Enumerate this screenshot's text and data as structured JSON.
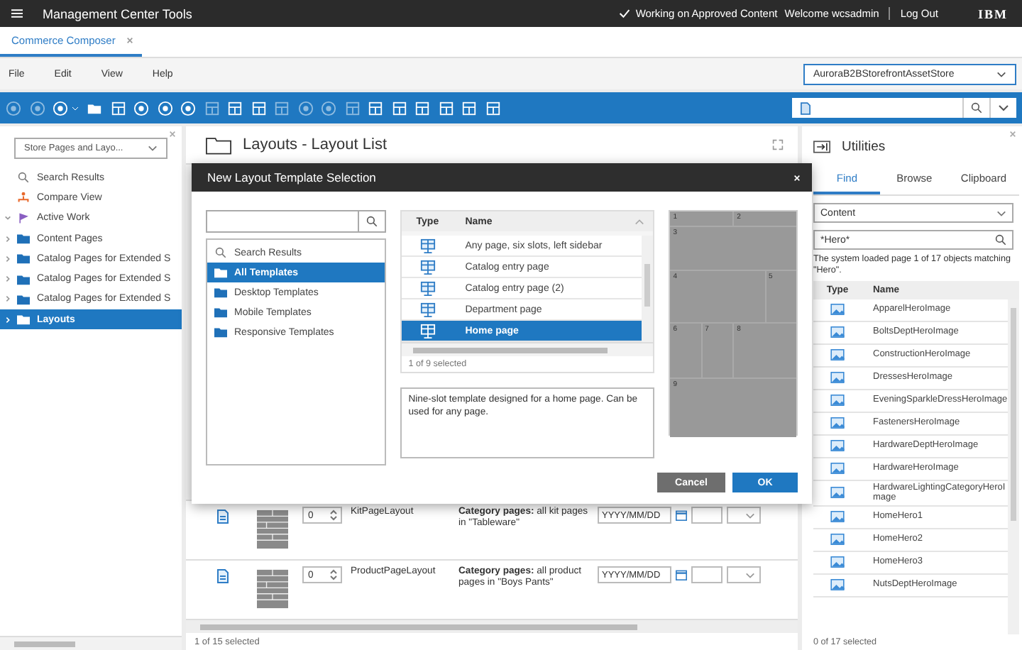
{
  "header": {
    "title": "Management Center Tools",
    "status": "Working on Approved Content",
    "welcome": "Welcome wcsadmin",
    "logout": "Log Out",
    "logo": "IBM"
  },
  "app_tabs": [
    {
      "label": "Commerce Composer",
      "selected": true
    }
  ],
  "menu": [
    "File",
    "Edit",
    "View",
    "Help"
  ],
  "store_selector": {
    "value": "AuroraB2BStorefrontAssetStore"
  },
  "explorer": {
    "view_selector": "Store Pages and Layo...",
    "items": [
      {
        "label": "Search Results",
        "kind": "search",
        "selected": false
      },
      {
        "label": "Compare View",
        "kind": "compare",
        "selected": false
      },
      {
        "label": "Active Work",
        "kind": "work",
        "expanded": true,
        "selected": false
      },
      {
        "label": "Content Pages",
        "kind": "folder",
        "expanded": false,
        "selected": false
      },
      {
        "label": "Catalog Pages for Extended S",
        "kind": "folder",
        "expanded": false,
        "selected": false
      },
      {
        "label": "Catalog Pages for Extended S",
        "kind": "folder",
        "expanded": false,
        "selected": false
      },
      {
        "label": "Catalog Pages for Extended S",
        "kind": "folder",
        "expanded": false,
        "selected": false
      },
      {
        "label": "Layouts",
        "kind": "folder",
        "expanded": false,
        "selected": true
      }
    ]
  },
  "layout_list": {
    "title": "Layouts - Layout List",
    "rows": [
      {
        "priority": "0",
        "name": "KitPageLayout",
        "description": "**Category pages:** all kit pages in \"Tableware\"",
        "date_placeholder": "YYYY/MM/DD",
        "selected": false
      },
      {
        "priority": "0",
        "name": "ProductPageLayout",
        "description": "**Category pages:** all product pages in \"Boys Pants\"",
        "date_placeholder": "YYYY/MM/DD",
        "selected": false
      }
    ],
    "status": "1 of 15 selected"
  },
  "dialog": {
    "title": "New Layout Template Selection",
    "folders": [
      {
        "label": "Search Results",
        "kind": "search",
        "selected": false
      },
      {
        "label": "All Templates",
        "kind": "folder",
        "selected": true
      },
      {
        "label": "Desktop Templates",
        "kind": "folder",
        "selected": false
      },
      {
        "label": "Mobile Templates",
        "kind": "folder",
        "selected": false
      },
      {
        "label": "Responsive Templates",
        "kind": "folder",
        "selected": false
      }
    ],
    "columns": [
      "Type",
      "Name"
    ],
    "templates": [
      {
        "name": "Any page, six slots, left sidebar",
        "selected": false
      },
      {
        "name": "Catalog entry page",
        "selected": false
      },
      {
        "name": "Catalog entry page (2)",
        "selected": false
      },
      {
        "name": "Department page",
        "selected": false
      },
      {
        "name": "Home page",
        "selected": true
      }
    ],
    "status": "1 of 9 selected",
    "description": "Nine-slot template designed for a home page. Can be used for any page.",
    "preview_slots": [
      "1",
      "2",
      "3",
      "4",
      "5",
      "6",
      "7",
      "8",
      "9"
    ],
    "buttons": [
      {
        "label": "Cancel",
        "kind": "secondary"
      },
      {
        "label": "OK",
        "kind": "primary"
      }
    ]
  },
  "utilities": {
    "title": "Utilities",
    "tabs": [
      {
        "label": "Find",
        "selected": true
      },
      {
        "label": "Browse",
        "selected": false
      },
      {
        "label": "Clipboard",
        "selected": false
      }
    ],
    "type_filter": "Content",
    "search": {
      "value": "*Hero*"
    },
    "message": "The system loaded page 1 of 17 objects matching \"Hero\".",
    "columns": [
      "Type",
      "Name"
    ],
    "rows": [
      "ApparelHeroImage",
      "BoltsDeptHeroImage",
      "ConstructionHeroImage",
      "DressesHeroImage",
      "EveningSparkleDressHeroImage",
      "FastenersHeroImage",
      "HardwareDeptHeroImage",
      "HardwareHeroImage",
      "HardwareLightingCategoryHeroImage",
      "HomeHero1",
      "HomeHero2",
      "HomeHero3",
      "NutsDeptHeroImage"
    ],
    "status": "0 of 17 selected"
  }
}
